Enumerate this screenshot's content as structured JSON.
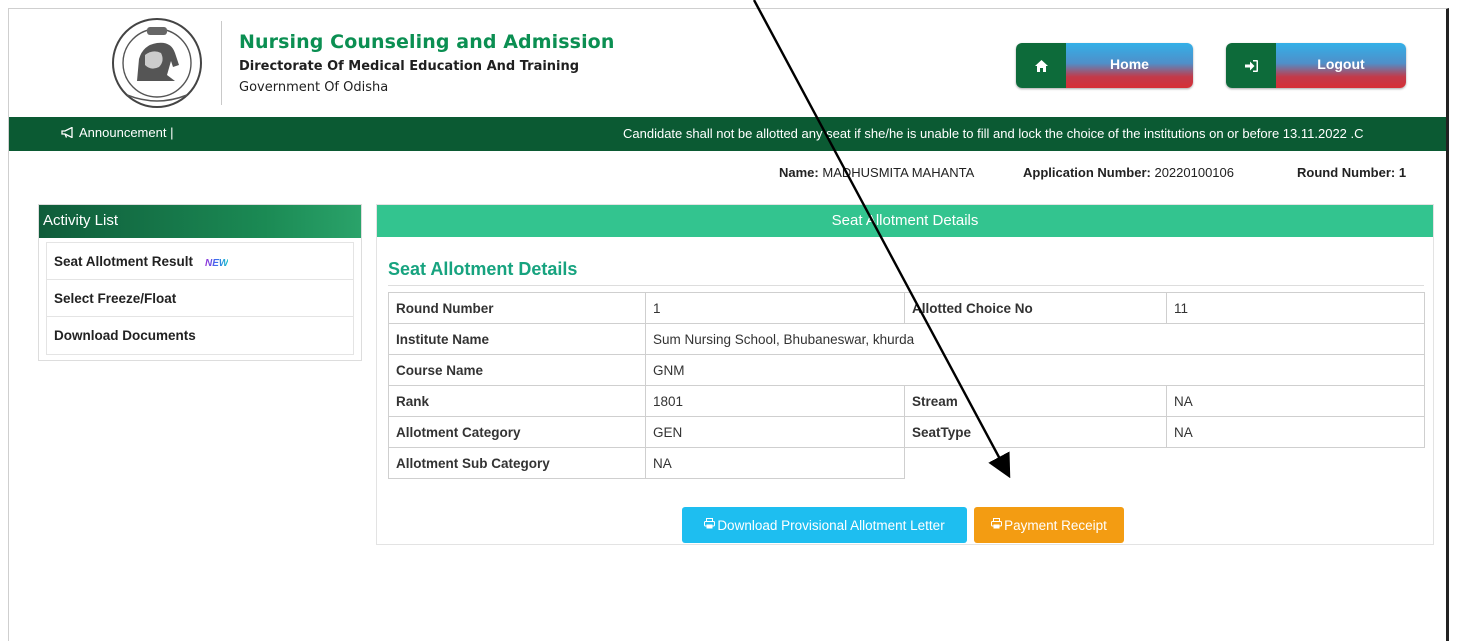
{
  "header": {
    "title": "Nursing Counseling and Admission",
    "subtitle": "Directorate Of Medical Education And Training",
    "org": "Government Of Odisha",
    "home_label": "Home",
    "logout_label": "Logout"
  },
  "announcement": {
    "label": "Announcement |",
    "text": "Candidate shall not be allotted any seat if she/he is unable to fill and lock the choice of the institutions on or before 13.11.2022 .C"
  },
  "info": {
    "name_label": "Name:",
    "name_value": "MADHUSMITA MAHANTA",
    "app_label": "Application Number:",
    "app_value": "20220100106",
    "round_label": "Round Number: 1"
  },
  "sidebar": {
    "title": "Activity List",
    "items": [
      {
        "label": "Seat Allotment Result",
        "badge": "NEW"
      },
      {
        "label": "Select Freeze/Float"
      },
      {
        "label": "Download Documents"
      }
    ]
  },
  "panel": {
    "header": "Seat Allotment Details",
    "section_title": "Seat Allotment Details",
    "round_number_label": "Round Number",
    "round_number": "1",
    "allotted_choice_label": "Allotted Choice No",
    "allotted_choice": "11",
    "institute_label": "Institute Name",
    "institute": "Sum Nursing School, Bhubaneswar, khurda",
    "course_label": "Course Name",
    "course": "GNM",
    "rank_label": "Rank",
    "rank": "1801",
    "stream_label": "Stream",
    "stream": "NA",
    "category_label": "Allotment Category",
    "category": "GEN",
    "seattype_label": "SeatType",
    "seattype": "NA",
    "subcategory_label": "Allotment Sub Category",
    "subcategory": "NA",
    "download_btn": "Download Provisional Allotment Letter",
    "payment_btn": "Payment Receipt"
  },
  "colors": {
    "brand_green": "#0b5a33",
    "title_green": "#0b8f52",
    "panel_header": "#33c48f",
    "download_blue": "#1ebef0",
    "payment_orange": "#f39c12"
  },
  "icons": [
    "state-emblem-icon",
    "home-icon",
    "sign-in-icon",
    "bullhorn-icon",
    "print-icon"
  ]
}
